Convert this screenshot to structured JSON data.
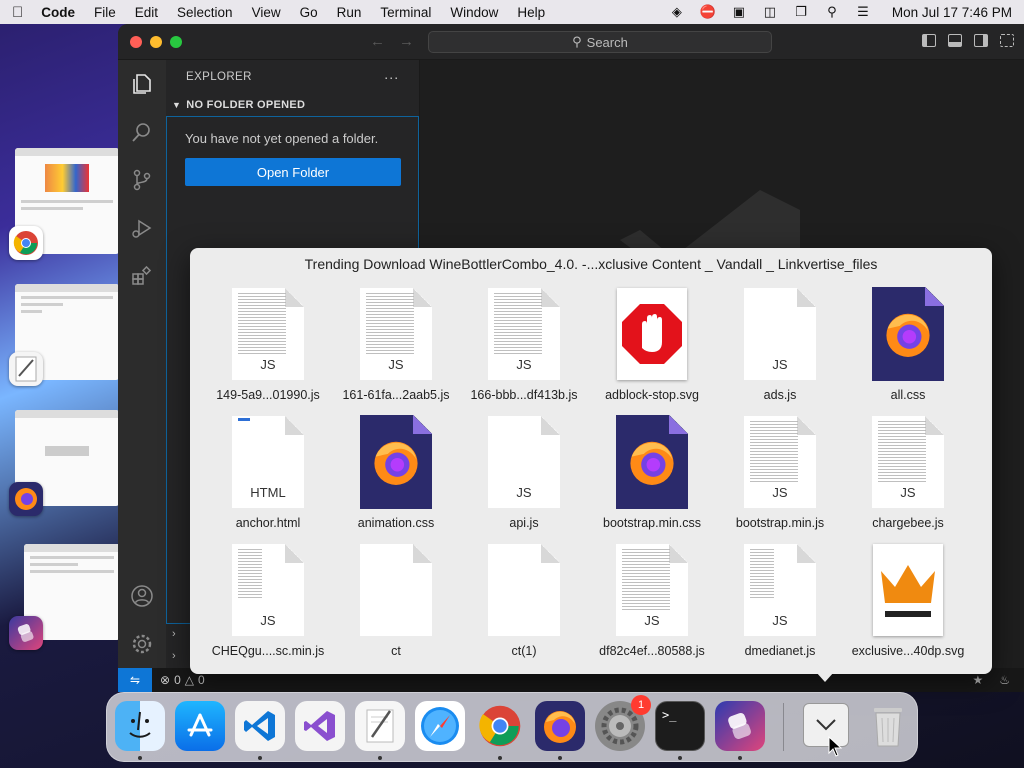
{
  "menubar": {
    "app_name": "Code",
    "items": [
      "File",
      "Edit",
      "Selection",
      "View",
      "Go",
      "Run",
      "Terminal",
      "Window",
      "Help"
    ],
    "clock": "Mon Jul 17  7:46 PM"
  },
  "vscode": {
    "search_label": "Search",
    "explorer_title": "EXPLORER",
    "explorer_more": "···",
    "section_title": "NO FOLDER OPENED",
    "no_folder_message": "You have not yet opened a folder.",
    "open_folder_label": "Open Folder",
    "status": {
      "errors": "0",
      "warnings": "0"
    }
  },
  "stack": {
    "title": "Trending Download WineBottlerCombo_4.0. -...xclusive Content _ Vandall _ Linkvertise_files",
    "files": [
      {
        "name": "149-5a9...01990.js",
        "kind": "text-doc",
        "ext": "JS"
      },
      {
        "name": "161-61fa...2aab5.js",
        "kind": "text-doc",
        "ext": "JS"
      },
      {
        "name": "166-bbb...df413b.js",
        "kind": "text-doc",
        "ext": "JS"
      },
      {
        "name": "adblock-stop.svg",
        "kind": "adblock-svg",
        "ext": ""
      },
      {
        "name": "ads.js",
        "kind": "blank-doc",
        "ext": "JS"
      },
      {
        "name": "all.css",
        "kind": "firefox-doc",
        "ext": ""
      },
      {
        "name": "anchor.html",
        "kind": "html-doc",
        "ext": "HTML"
      },
      {
        "name": "animation.css",
        "kind": "firefox-doc",
        "ext": ""
      },
      {
        "name": "api.js",
        "kind": "blank-doc",
        "ext": "JS"
      },
      {
        "name": "bootstrap.min.css",
        "kind": "firefox-doc",
        "ext": ""
      },
      {
        "name": "bootstrap.min.js",
        "kind": "text-doc",
        "ext": "JS"
      },
      {
        "name": "chargebee.js",
        "kind": "text-doc",
        "ext": "JS"
      },
      {
        "name": "CHEQgu....sc.min.js",
        "kind": "short-doc",
        "ext": "JS"
      },
      {
        "name": "ct",
        "kind": "blank-doc",
        "ext": ""
      },
      {
        "name": "ct(1)",
        "kind": "blank-doc",
        "ext": ""
      },
      {
        "name": "df82c4ef...80588.js",
        "kind": "text-doc",
        "ext": "JS"
      },
      {
        "name": "dmedianet.js",
        "kind": "short-doc",
        "ext": "JS"
      },
      {
        "name": "exclusive...40dp.svg",
        "kind": "crown-svg",
        "ext": ""
      }
    ]
  },
  "dock": {
    "apps": [
      "finder",
      "app-store",
      "vscode",
      "visual-studio",
      "textedit",
      "safari",
      "chrome",
      "firefox",
      "system-settings",
      "terminal",
      "shortcuts"
    ],
    "settings_badge": "1"
  }
}
